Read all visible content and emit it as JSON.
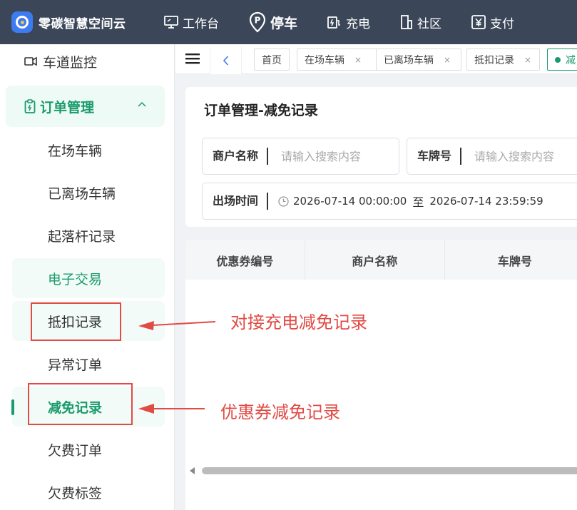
{
  "app": {
    "title": "零碳智慧空间云"
  },
  "nav": {
    "items": [
      {
        "label": "工作台",
        "icon": "monitor-icon"
      },
      {
        "label": "停车",
        "icon": "parking-icon",
        "active": true
      },
      {
        "label": "充电",
        "icon": "charging-icon"
      },
      {
        "label": "社区",
        "icon": "building-icon"
      },
      {
        "label": "支付",
        "icon": "yen-icon"
      }
    ]
  },
  "sidebar": {
    "top_item": "车道监控",
    "group": "订单管理",
    "items": [
      "在场车辆",
      "已离场车辆",
      "起落杆记录",
      "电子交易",
      "抵扣记录",
      "异常订单",
      "减免记录",
      "欠费订单",
      "欠费标签"
    ]
  },
  "tabs": {
    "items": [
      "首页",
      "在场车辆",
      "已离场车辆",
      "抵扣记录"
    ],
    "active_partial": "减",
    "close_glyph": "×"
  },
  "page": {
    "title": "订单管理-减免记录",
    "merchant_label": "商户名称",
    "merchant_placeholder": "请输入搜索内容",
    "plate_label": "车牌号",
    "plate_placeholder": "请输入搜索内容",
    "exit_time_label": "出场时间",
    "exit_time_start": "2026-07-14 00:00:00",
    "exit_time_sep": "至",
    "exit_time_end": "2026-07-14 23:59:59"
  },
  "table": {
    "columns": [
      "优惠券编号",
      "商户名称",
      "车牌号"
    ]
  },
  "annotations": {
    "deduction": "对接充电减免记录",
    "reduction": "优惠券减免记录"
  },
  "colors": {
    "accent": "#1a9b6c",
    "topbar": "#3b4658",
    "annotation": "#e24a44"
  }
}
